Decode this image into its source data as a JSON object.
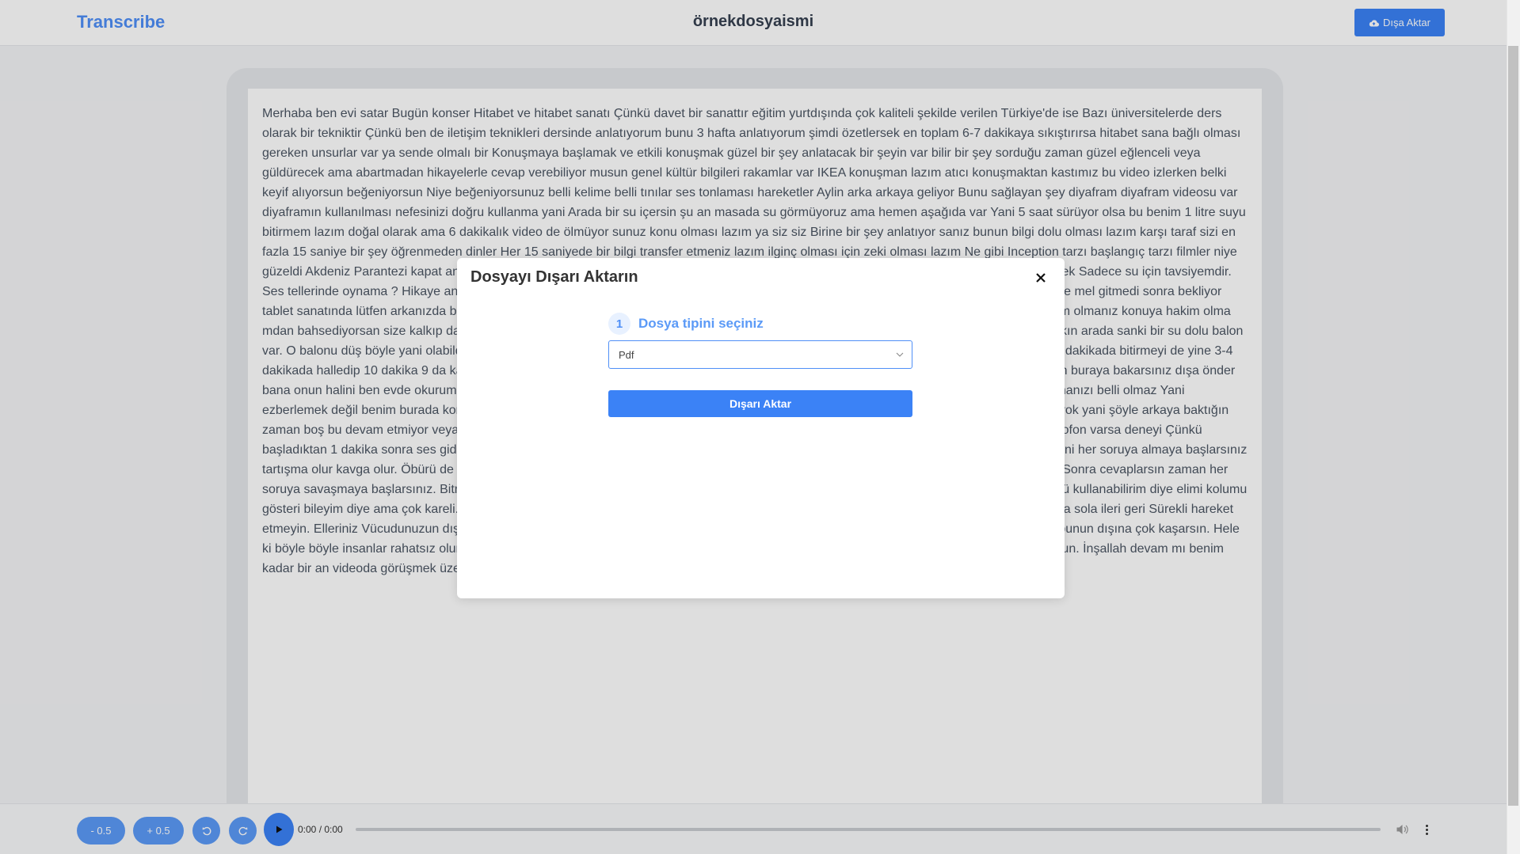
{
  "header": {
    "brand": "Transcribe",
    "title": "örnekdosyaismi",
    "export_label": "Dışa Aktar"
  },
  "transcript": "Merhaba ben evi satar Bugün konser Hitabet ve hitabet sanatı Çünkü davet bir sanattır eğitim yurtdışında çok kaliteli şekilde verilen Türkiye'de ise Bazı üniversitelerde ders olarak bir tekniktir Çünkü ben de iletişim teknikleri dersinde anlatıyorum bunu 3 hafta anlatıyorum şimdi özetlersek en toplam 6-7 dakikaya sıkıştırırsa hitabet sana bağlı olması gereken unsurlar var ya sende olmalı bir Konuşmaya başlamak ve etkili konuşmak güzel bir şey anlatacak bir şeyin var bilir bir şey sorduğu zaman güzel eğlenceli veya güldürecek ama abartmadan hikayelerle cevap verebiliyor musun genel kültür bilgileri rakamlar var IKEA konuşman lazım atıcı konuşmaktan kastımız bu video izlerken belki keyif alıyorsun beğeniyorsun Niye beğeniyorsunuz belli kelime belli tınılar ses tonlaması hareketler Aylin arka arkaya geliyor Bunu sağlayan şey diyafram diyafram videosu var diyaframın kullanılması nefesinizi doğru kullanma yani Arada bir su içersin şu an masada su görmüyoruz ama hemen aşağıda var Yani 5 saat sürüyor olsa bu benim 1 litre suyu bitirmem lazım doğal olarak ama 6 dakikalık video de ölmüyor sunuz konu olması lazım ya siz siz Birine bir şey anlatıyor sanız bunun bilgi dolu olması lazım karşı taraf sizi en fazla 15 saniye bir şey öğrenmeden dinler Her 15 saniyede bir bilgi transfer etmeniz lazım ilginç olması için zeki olması lazım Ne gibi Inception tarzı başlangıç tarzı filmler niye güzeldi Akdeniz Parantezi kapat an böyle oradan oraya atıp da bu zek itabet sanatı daha sonra cevaplar savaşa girmeyi sinirle laz ecek tüketmek Sadece su için tavsiyemdir. Ses tellerinde oynama ? Hikaye anlatma çok saçmadır. Insanlar eğer bunu diye ğit Dakikasını hikaye ayırdığı zaman genelde kendi hayat hikaye mel gitmedi sonra bekliyor tablet sanatında lütfen arkanızda buluna şöyle özeti olan iki üç satırlık iki üç kelimelik bolca resimli görselliğ ka olur bir başka konu konuya hakim olmanız konuya hakim olma mdan bahsediyorsan size kalkıp da ekonomide Bursa'dan ba bitmeyecek. Bu Ben de iyiyim beden dili El kol Minikler en çok bu olabildiğince yakın arada sanki bir su dolu balon var. O balonu düş böyle yani olabildiğince ellerinizle bilme yakın ve karşıya g acia onu hiç konuşmuyorsun zaman yönetimi konuşamayacağır 5 dakikada bitirmeyi de yine 3-4 dakikada halledip 10 dakika 9 da kaybedersin. Uyurlar sorun yok yani size şekli dinlemeleri için en s seminer verirken yana hitabette bulunurken buraya bakarsınız dışa önder bana onun halini ben evde okurum yani sana ihtiyacım var o ıldırı Herkes yapar. Bende de bir iki defa duyarsınız ama en en önemli şey konuşmanızı belli olmaz Yani ezberlemek değil benim burada konuşmamanın ana başlıkları iki üç kelime ile var ya burada 10 satır 20 satır yazı olur En fazla Uzun bir metin yok yani şöyle arkaya baktığın zaman boş bu devam etmiyor veya sayfa çeviriyorum. Ama bu hatırlatıcılar önemlidir. 13 bilgisi ses sistemi kullanacaksınız tanıyın Yani bir mikrofon varsa deneyi Çünkü başladıktan 1 dakika sonra ses giderse rezil olursunuz. Ikinci son hatırlatacağım toplasın diye lütfen insandan soru sorduğu zaman durdurun yani her soruya almaya başlarsınız tartışma olur kavga olur. Öbürü de soru sormak istemek konuşmanız iyi bir tablet soru almaz araya sonra cevaplar soruları geleceğim dersiniz. Sonra cevaplarsın zaman her soruya savaşmaya başlarsınız. Bitme ve diğer önemli görse Sizde ne var malzeme olarak yani ben eğer ki siyah dinliyorsan beden dedim önünü kullanabilirim diye elimi kolumu gösteri bileyim diye ama çok kareli. Tazmanya canavarlı kravatlı gömlek nin rengarenk olmaz davetinizi dağıtır. Lütfen hitabet sırasında çok sağa sola ileri geri Sürekli hareket etmeyin. Elleriniz Vücudunuzun dışına çıkmasın Mümkünse Yani çok da gördünüz mü dikdörtgen var ya şu dikdörtgen Bunun için de konuşun bunun dışına çok kaşarsın. Hele ki böyle böyle insanlar rahatsız olur. Hitabet sanatının kısaca değinmek istedik sizden çok soru geldi oraya nasıl konuşalım diye o bir bölüm olsun. İnşallah devam mı benim kadar bir an videoda görüşmek üzere",
  "modal": {
    "title": "Dosyayı Dışarı Aktarın",
    "step_number": "1",
    "step_label": "Dosya tipini seçiniz",
    "selected_format": "Pdf",
    "submit_label": "Dışarı Aktar"
  },
  "player": {
    "back_label": "- 0.5",
    "forward_label": "+ 0.5",
    "time": "0:00 / 0:00",
    "progress": 0
  },
  "colors": {
    "accent": "#3b82f6",
    "brand": "#4f8ff7"
  },
  "icons": [
    "cloud-upload-icon",
    "close-icon",
    "chevron-down-icon",
    "rewind-icon",
    "forward-icon",
    "play-icon",
    "volume-icon",
    "more-vertical-icon"
  ]
}
